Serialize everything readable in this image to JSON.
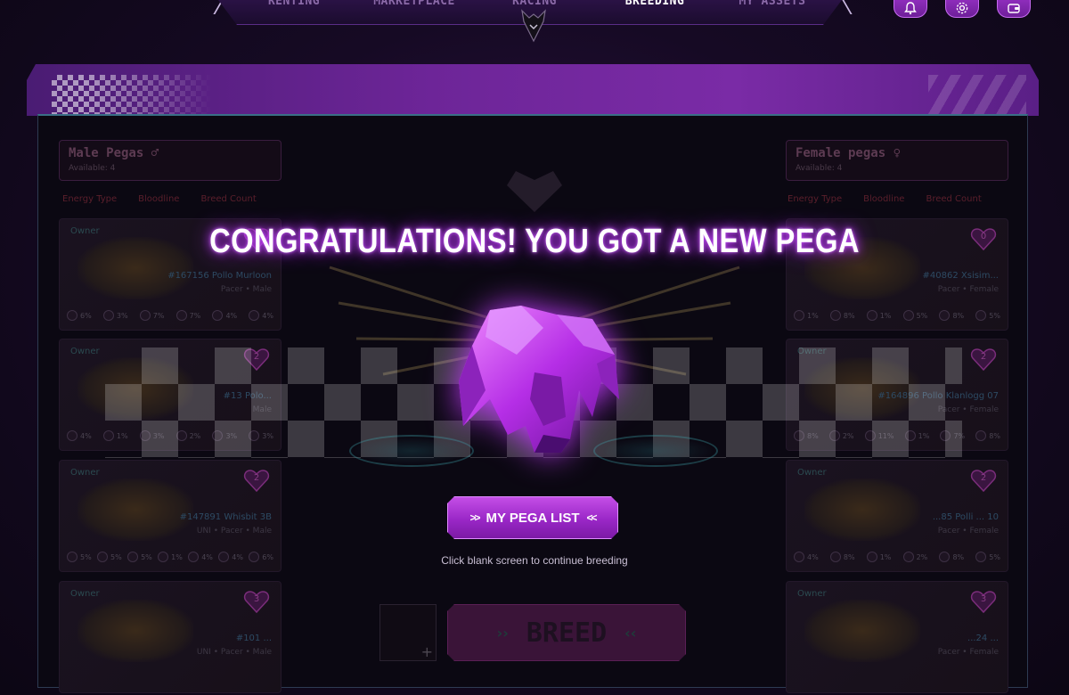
{
  "nav": {
    "tabs": [
      {
        "label": "RENTING",
        "active": false
      },
      {
        "label": "MARKETPLACE",
        "active": false
      },
      {
        "label": "RACING",
        "active": false
      },
      {
        "label": "BREEDING",
        "active": true
      },
      {
        "label": "MY ASSETS",
        "active": false
      }
    ],
    "icons": [
      "bell-icon",
      "gear-icon",
      "wallet-icon"
    ]
  },
  "male": {
    "title": "Male Pegas ♂",
    "available": "Available: 4",
    "filters": [
      "Energy Type",
      "Bloodline",
      "Breed Count"
    ],
    "cards": [
      {
        "owner": "Owner",
        "breed_count": "",
        "name": "#167156 Pollo Murloon",
        "meta": "Pacer • Male",
        "stats": [
          "6%",
          "3%",
          "7%",
          "7%",
          "4%",
          "4%"
        ]
      },
      {
        "owner": "Owner",
        "breed_count": "2",
        "name": "#13 Polo...",
        "meta": "Male",
        "stats": [
          "4%",
          "1%",
          "3%",
          "2%",
          "3%",
          "3%"
        ]
      },
      {
        "owner": "Owner",
        "breed_count": "2",
        "name": "#147891 Whisbit 3B",
        "meta": "UNI • Pacer • Male",
        "stats": [
          "5%",
          "5%",
          "5%",
          "1%",
          "4%",
          "4%",
          "6%"
        ]
      },
      {
        "owner": "Owner",
        "breed_count": "3",
        "name": "#101 ...",
        "meta": "UNI • Pacer • Male",
        "stats": []
      }
    ]
  },
  "female": {
    "title": "Female pegas ♀",
    "available": "Available: 4",
    "filters": [
      "Energy Type",
      "Bloodline",
      "Breed Count"
    ],
    "cards": [
      {
        "owner": "Owner",
        "breed_count": "0",
        "name": "#40862 Xsisim...",
        "meta": "Pacer • Female",
        "stats": [
          "1%",
          "8%",
          "1%",
          "5%",
          "8%",
          "5%"
        ]
      },
      {
        "owner": "Owner",
        "breed_count": "2",
        "name": "#164896 Pollo Klanlogg 07",
        "meta": "Pacer • Female",
        "stats": [
          "8%",
          "2%",
          "11%",
          "1%",
          "7%",
          "8%"
        ]
      },
      {
        "owner": "Owner",
        "breed_count": "2",
        "name": "...85 Polli ... 10",
        "meta": "Pacer • Female",
        "stats": [
          "4%",
          "8%",
          "1%",
          "2%",
          "8%",
          "5%"
        ]
      },
      {
        "owner": "Owner",
        "breed_count": "3",
        "name": "...24 ...",
        "meta": "Pacer • Female",
        "stats": []
      }
    ]
  },
  "breed": {
    "label": "BREED",
    "slot_icon": "plus-icon"
  },
  "overlay": {
    "title": "CONGRATULATIONS! YOU GOT A NEW PEGA",
    "button_label": "MY PEGA LIST",
    "hint": "Click blank screen to continue breeding"
  },
  "colors": {
    "accent": "#a930d6",
    "glow": "#c13bff",
    "panel": "#0b0812"
  }
}
